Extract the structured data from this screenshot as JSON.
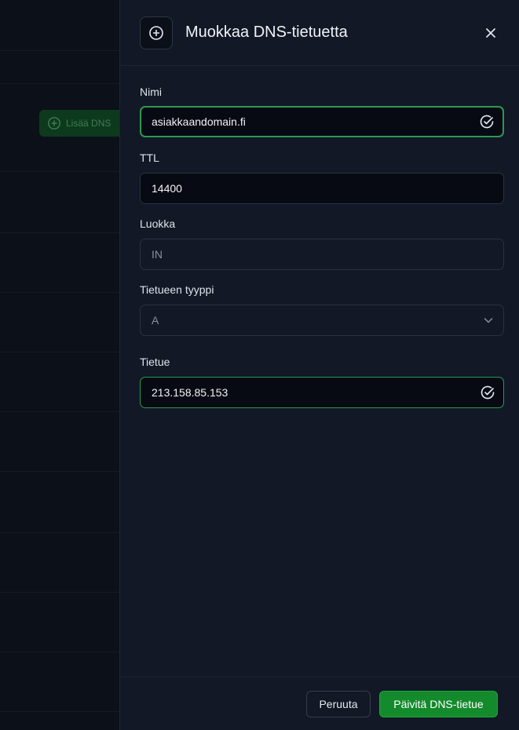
{
  "background": {
    "add_button_label": "Lisää DNS"
  },
  "drawer": {
    "title": "Muokkaa DNS-tietuetta",
    "fields": {
      "name": {
        "label": "Nimi",
        "value": "asiakkaandomain.fi"
      },
      "ttl": {
        "label": "TTL",
        "value": "14400"
      },
      "class": {
        "label": "Luokka",
        "value": "IN"
      },
      "type": {
        "label": "Tietueen tyyppi",
        "value": "A"
      },
      "record": {
        "label": "Tietue",
        "value": "213.158.85.153"
      }
    },
    "footer": {
      "cancel_label": "Peruuta",
      "submit_label": "Päivitä DNS-tietue"
    }
  },
  "colors": {
    "accent_green": "#138a2c",
    "valid_border": "#2a9b52",
    "panel_bg": "#121826",
    "input_bg": "#070a12"
  },
  "icons": {
    "header": "plus-circle-icon",
    "close": "close-icon",
    "valid": "check-circle-icon",
    "select": "chevron-down-icon"
  }
}
